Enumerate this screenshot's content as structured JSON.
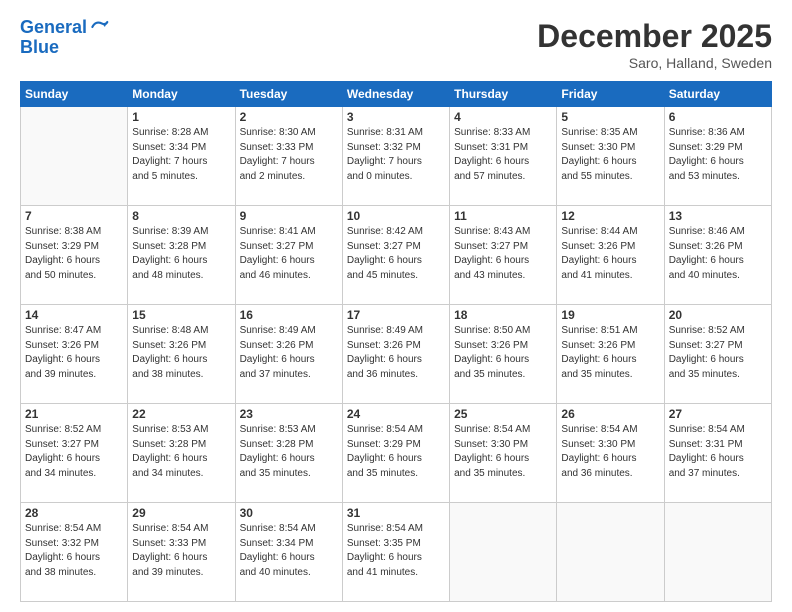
{
  "logo": {
    "line1": "General",
    "line2": "Blue"
  },
  "title": "December 2025",
  "subtitle": "Saro, Halland, Sweden",
  "weekdays": [
    "Sunday",
    "Monday",
    "Tuesday",
    "Wednesday",
    "Thursday",
    "Friday",
    "Saturday"
  ],
  "weeks": [
    [
      {
        "day": "",
        "info": ""
      },
      {
        "day": "1",
        "info": "Sunrise: 8:28 AM\nSunset: 3:34 PM\nDaylight: 7 hours\nand 5 minutes."
      },
      {
        "day": "2",
        "info": "Sunrise: 8:30 AM\nSunset: 3:33 PM\nDaylight: 7 hours\nand 2 minutes."
      },
      {
        "day": "3",
        "info": "Sunrise: 8:31 AM\nSunset: 3:32 PM\nDaylight: 7 hours\nand 0 minutes."
      },
      {
        "day": "4",
        "info": "Sunrise: 8:33 AM\nSunset: 3:31 PM\nDaylight: 6 hours\nand 57 minutes."
      },
      {
        "day": "5",
        "info": "Sunrise: 8:35 AM\nSunset: 3:30 PM\nDaylight: 6 hours\nand 55 minutes."
      },
      {
        "day": "6",
        "info": "Sunrise: 8:36 AM\nSunset: 3:29 PM\nDaylight: 6 hours\nand 53 minutes."
      }
    ],
    [
      {
        "day": "7",
        "info": "Sunrise: 8:38 AM\nSunset: 3:29 PM\nDaylight: 6 hours\nand 50 minutes."
      },
      {
        "day": "8",
        "info": "Sunrise: 8:39 AM\nSunset: 3:28 PM\nDaylight: 6 hours\nand 48 minutes."
      },
      {
        "day": "9",
        "info": "Sunrise: 8:41 AM\nSunset: 3:27 PM\nDaylight: 6 hours\nand 46 minutes."
      },
      {
        "day": "10",
        "info": "Sunrise: 8:42 AM\nSunset: 3:27 PM\nDaylight: 6 hours\nand 45 minutes."
      },
      {
        "day": "11",
        "info": "Sunrise: 8:43 AM\nSunset: 3:27 PM\nDaylight: 6 hours\nand 43 minutes."
      },
      {
        "day": "12",
        "info": "Sunrise: 8:44 AM\nSunset: 3:26 PM\nDaylight: 6 hours\nand 41 minutes."
      },
      {
        "day": "13",
        "info": "Sunrise: 8:46 AM\nSunset: 3:26 PM\nDaylight: 6 hours\nand 40 minutes."
      }
    ],
    [
      {
        "day": "14",
        "info": "Sunrise: 8:47 AM\nSunset: 3:26 PM\nDaylight: 6 hours\nand 39 minutes."
      },
      {
        "day": "15",
        "info": "Sunrise: 8:48 AM\nSunset: 3:26 PM\nDaylight: 6 hours\nand 38 minutes."
      },
      {
        "day": "16",
        "info": "Sunrise: 8:49 AM\nSunset: 3:26 PM\nDaylight: 6 hours\nand 37 minutes."
      },
      {
        "day": "17",
        "info": "Sunrise: 8:49 AM\nSunset: 3:26 PM\nDaylight: 6 hours\nand 36 minutes."
      },
      {
        "day": "18",
        "info": "Sunrise: 8:50 AM\nSunset: 3:26 PM\nDaylight: 6 hours\nand 35 minutes."
      },
      {
        "day": "19",
        "info": "Sunrise: 8:51 AM\nSunset: 3:26 PM\nDaylight: 6 hours\nand 35 minutes."
      },
      {
        "day": "20",
        "info": "Sunrise: 8:52 AM\nSunset: 3:27 PM\nDaylight: 6 hours\nand 35 minutes."
      }
    ],
    [
      {
        "day": "21",
        "info": "Sunrise: 8:52 AM\nSunset: 3:27 PM\nDaylight: 6 hours\nand 34 minutes."
      },
      {
        "day": "22",
        "info": "Sunrise: 8:53 AM\nSunset: 3:28 PM\nDaylight: 6 hours\nand 34 minutes."
      },
      {
        "day": "23",
        "info": "Sunrise: 8:53 AM\nSunset: 3:28 PM\nDaylight: 6 hours\nand 35 minutes."
      },
      {
        "day": "24",
        "info": "Sunrise: 8:54 AM\nSunset: 3:29 PM\nDaylight: 6 hours\nand 35 minutes."
      },
      {
        "day": "25",
        "info": "Sunrise: 8:54 AM\nSunset: 3:30 PM\nDaylight: 6 hours\nand 35 minutes."
      },
      {
        "day": "26",
        "info": "Sunrise: 8:54 AM\nSunset: 3:30 PM\nDaylight: 6 hours\nand 36 minutes."
      },
      {
        "day": "27",
        "info": "Sunrise: 8:54 AM\nSunset: 3:31 PM\nDaylight: 6 hours\nand 37 minutes."
      }
    ],
    [
      {
        "day": "28",
        "info": "Sunrise: 8:54 AM\nSunset: 3:32 PM\nDaylight: 6 hours\nand 38 minutes."
      },
      {
        "day": "29",
        "info": "Sunrise: 8:54 AM\nSunset: 3:33 PM\nDaylight: 6 hours\nand 39 minutes."
      },
      {
        "day": "30",
        "info": "Sunrise: 8:54 AM\nSunset: 3:34 PM\nDaylight: 6 hours\nand 40 minutes."
      },
      {
        "day": "31",
        "info": "Sunrise: 8:54 AM\nSunset: 3:35 PM\nDaylight: 6 hours\nand 41 minutes."
      },
      {
        "day": "",
        "info": ""
      },
      {
        "day": "",
        "info": ""
      },
      {
        "day": "",
        "info": ""
      }
    ]
  ]
}
